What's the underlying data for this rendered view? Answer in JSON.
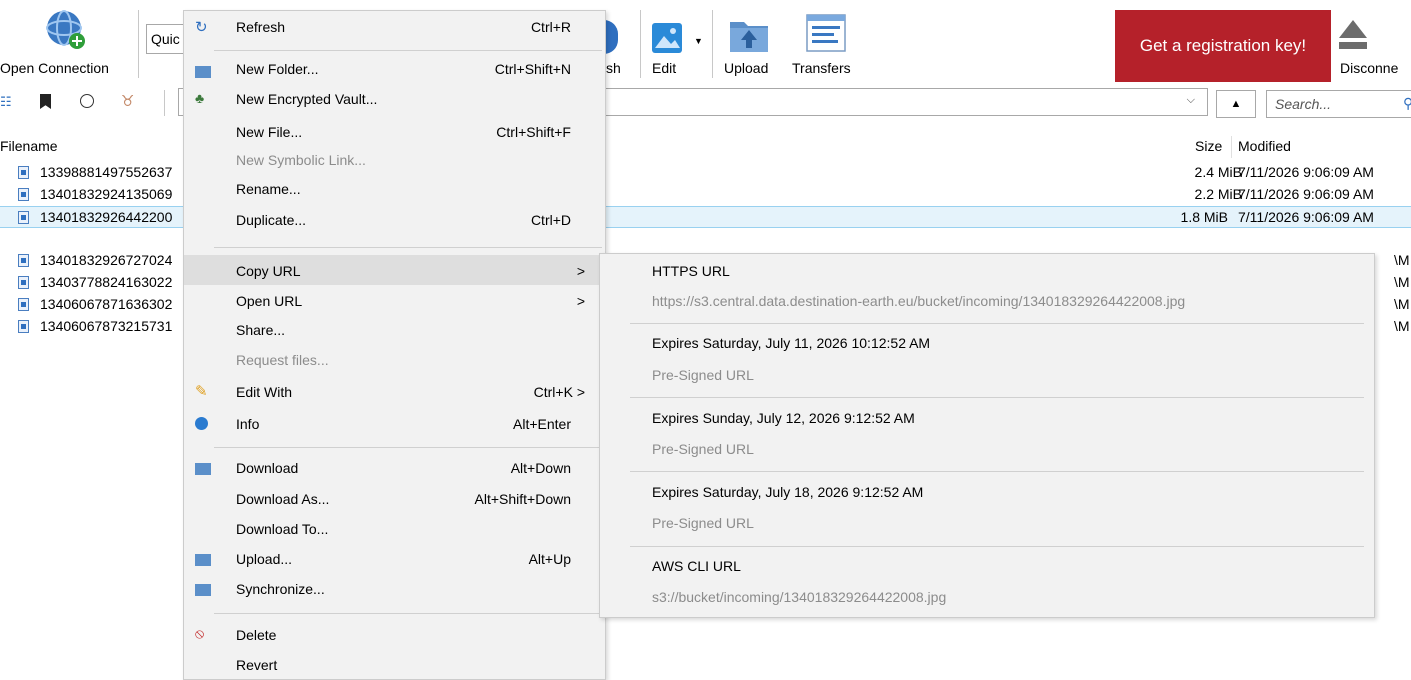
{
  "toolbar": {
    "open_connection": "Open Connection",
    "quick_connect_value": "Quic",
    "refresh_partial": "sh",
    "edit": "Edit",
    "upload": "Upload",
    "transfers": "Transfers",
    "disconnect_partial": "Disconne",
    "registration": "Get a registration key!",
    "search_placeholder": "Search..."
  },
  "file_list": {
    "col_filename": "Filename",
    "col_size": "Size",
    "col_modified": "Modified",
    "rows": [
      {
        "name": "13398881497552637",
        "size": "2.4 MiB",
        "modified": "7/11/2026 9:06:09 AM"
      },
      {
        "name": "13401832924135069",
        "size": "2.2 MiB",
        "modified": "7/11/2026 9:06:09 AM"
      },
      {
        "name": "13401832926442200",
        "size": "1.8 MiB",
        "modified": "7/11/2026 9:06:09 AM"
      },
      {
        "name": "13401832926727024",
        "size": "",
        "modified": "\\M"
      },
      {
        "name": "13403778824163022",
        "size": "",
        "modified": "\\M"
      },
      {
        "name": "13406067871636302",
        "size": "",
        "modified": "\\M"
      },
      {
        "name": "13406067873215731",
        "size": "",
        "modified": "\\M"
      }
    ]
  },
  "context_menu": {
    "refresh": {
      "label": "Refresh",
      "shortcut": "Ctrl+R"
    },
    "new_folder": {
      "label": "New Folder...",
      "shortcut": "Ctrl+Shift+N"
    },
    "new_vault": {
      "label": "New Encrypted Vault..."
    },
    "new_file": {
      "label": "New File...",
      "shortcut": "Ctrl+Shift+F"
    },
    "new_symlink": {
      "label": "New Symbolic Link..."
    },
    "rename": {
      "label": "Rename..."
    },
    "duplicate": {
      "label": "Duplicate...",
      "shortcut": "Ctrl+D"
    },
    "copy_url": {
      "label": "Copy URL",
      "arrow": ">"
    },
    "open_url": {
      "label": "Open URL",
      "arrow": ">"
    },
    "share": {
      "label": "Share..."
    },
    "request_files": {
      "label": "Request files..."
    },
    "edit_with": {
      "label": "Edit With",
      "shortcut": "Ctrl+K >"
    },
    "info": {
      "label": "Info",
      "shortcut": "Alt+Enter"
    },
    "download": {
      "label": "Download",
      "shortcut": "Alt+Down"
    },
    "download_as": {
      "label": "Download As...",
      "shortcut": "Alt+Shift+Down"
    },
    "download_to": {
      "label": "Download To..."
    },
    "upload": {
      "label": "Upload...",
      "shortcut": "Alt+Up"
    },
    "synchronize": {
      "label": "Synchronize..."
    },
    "delete": {
      "label": "Delete"
    },
    "revert": {
      "label": "Revert"
    }
  },
  "copy_url_submenu": {
    "https_title": "HTTPS URL",
    "https_url": "https://s3.central.data.destination-earth.eu/bucket/incoming/134018329264422008.jpg",
    "expires_1": "Expires Saturday, July 11, 2026 10:12:52 AM",
    "expires_2": "Expires Sunday, July 12, 2026 9:12:52 AM",
    "expires_3": "Expires Saturday, July 18, 2026 9:12:52 AM",
    "presigned": "Pre-Signed URL",
    "aws_title": "AWS CLI URL",
    "aws_url": "s3://bucket/incoming/134018329264422008.jpg"
  },
  "colors": {
    "registration_bg": "#b5212a",
    "selection": "#e5f3fb"
  }
}
